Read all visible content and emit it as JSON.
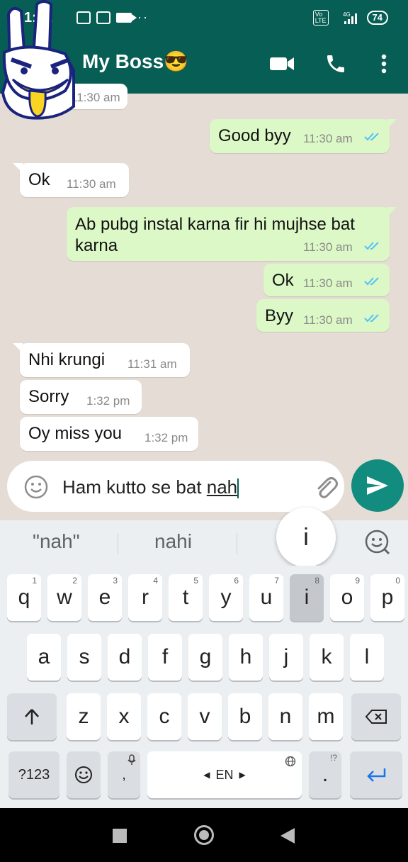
{
  "status_bar": {
    "time": "1:41",
    "battery": "74",
    "network": "4G"
  },
  "chat_header": {
    "contact_name": "My Boss😎"
  },
  "partial_top_time": "11:30 am",
  "messages": [
    {
      "direction": "out",
      "text": "Good byy",
      "time": "11:30 am",
      "status": "read"
    },
    {
      "direction": "in",
      "text": "Ok",
      "time": "11:30 am"
    },
    {
      "direction": "out",
      "text": "Ab pubg instal karna fir hi mujhse bat karna",
      "time": "11:30 am",
      "status": "read"
    },
    {
      "direction": "out",
      "text": "Ok",
      "time": "11:30 am",
      "status": "read"
    },
    {
      "direction": "out",
      "text": "Byy",
      "time": "11:30 am",
      "status": "read"
    },
    {
      "direction": "in",
      "text": "Nhi krungi",
      "time": "11:31 am"
    },
    {
      "direction": "in",
      "text": "Sorry",
      "time": "1:32 pm"
    },
    {
      "direction": "in",
      "text": "Oy miss you",
      "time": "1:32 pm"
    }
  ],
  "composer": {
    "text_before": "Ham kutto se bat ",
    "text_composing": "nah"
  },
  "keyboard": {
    "suggestions": [
      "\"nah\"",
      "nahi"
    ],
    "key_popup": "i",
    "row1": [
      {
        "k": "q",
        "h": "1"
      },
      {
        "k": "w",
        "h": "2"
      },
      {
        "k": "e",
        "h": "3"
      },
      {
        "k": "r",
        "h": "4"
      },
      {
        "k": "t",
        "h": "5"
      },
      {
        "k": "y",
        "h": "6"
      },
      {
        "k": "u",
        "h": "7"
      },
      {
        "k": "i",
        "h": "8"
      },
      {
        "k": "o",
        "h": "9"
      },
      {
        "k": "p",
        "h": "0"
      }
    ],
    "row2": [
      "a",
      "s",
      "d",
      "f",
      "g",
      "h",
      "j",
      "k",
      "l"
    ],
    "row3": [
      "z",
      "x",
      "c",
      "v",
      "b",
      "n",
      "m"
    ],
    "symbols_key": "?123",
    "comma_key": ",",
    "space_label": "EN",
    "period_key": ".",
    "period_hint": "!?"
  }
}
